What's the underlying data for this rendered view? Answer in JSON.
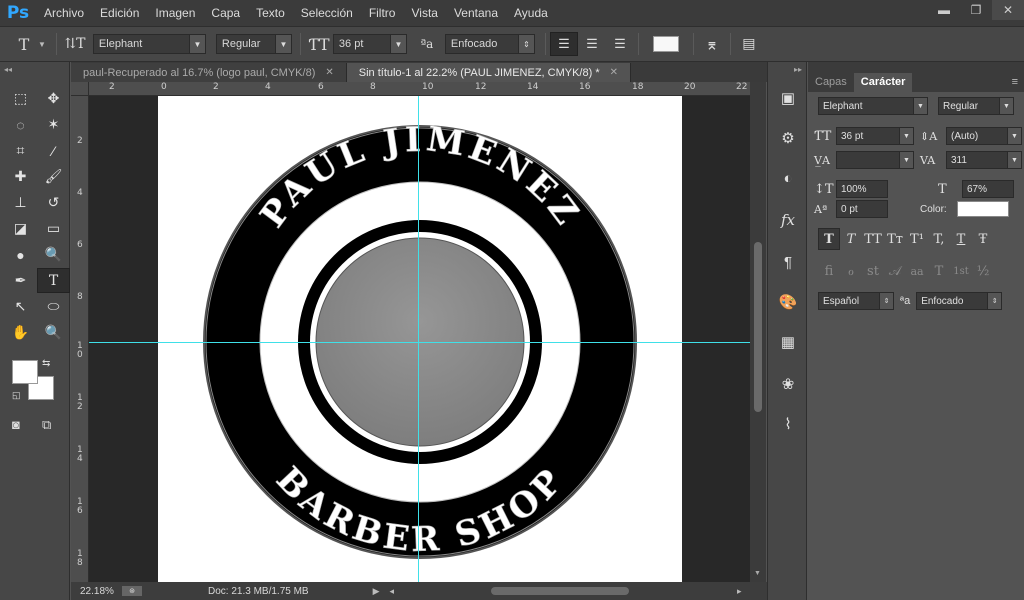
{
  "app": {
    "logo": "Ps"
  },
  "menu": [
    "Archivo",
    "Edición",
    "Imagen",
    "Capa",
    "Texto",
    "Selección",
    "Filtro",
    "Vista",
    "Ventana",
    "Ayuda"
  ],
  "options": {
    "font_family": "Elephant",
    "font_style": "Regular",
    "font_size": "36 pt",
    "antialias": "Enfocado"
  },
  "tabs": [
    {
      "label": "paul-Recuperado al 16.7% (logo paul, CMYK/8)"
    },
    {
      "label": "Sin título-1 al 22.2% (PAUL JIMENEZ, CMYK/8) *"
    }
  ],
  "rulers": {
    "top": [
      "2",
      "0",
      "2",
      "4",
      "6",
      "8",
      "10",
      "12",
      "14",
      "16",
      "18",
      "20",
      "22"
    ],
    "left": [
      "2",
      "4",
      "6",
      "8",
      "1\n0",
      "1\n2",
      "1\n4",
      "1\n6",
      "1\n8"
    ]
  },
  "logo": {
    "top_text": "PAUL JIMENEZ",
    "bottom_text": "BARBER SHOP"
  },
  "status": {
    "zoom": "22.18%",
    "doc": "Doc: 21.3 MB/1.75 MB"
  },
  "panel": {
    "tabs": [
      "Capas",
      "Carácter"
    ],
    "font_family": "Elephant",
    "font_style": "Regular",
    "size": "36 pt",
    "leading": "(Auto)",
    "kerning": "",
    "tracking": "311",
    "vscale": "100%",
    "hscale": "67%",
    "baseline": "0 pt",
    "color_label": "Color:",
    "language": "Español",
    "antialias": "Enfocado",
    "style_buttons": [
      "T",
      "T",
      "TT",
      "Tт",
      "T¹",
      "T,",
      "T",
      "Ŧ"
    ],
    "ot_buttons": [
      "fi",
      "ℴ",
      "st",
      "𝒜",
      "aa",
      "T",
      "1st",
      "½"
    ]
  },
  "colors": {
    "accent": "#31a8ff",
    "guide": "#3fe0e8",
    "logo_ring": "#000000",
    "logo_center": "#8e8e8e"
  }
}
